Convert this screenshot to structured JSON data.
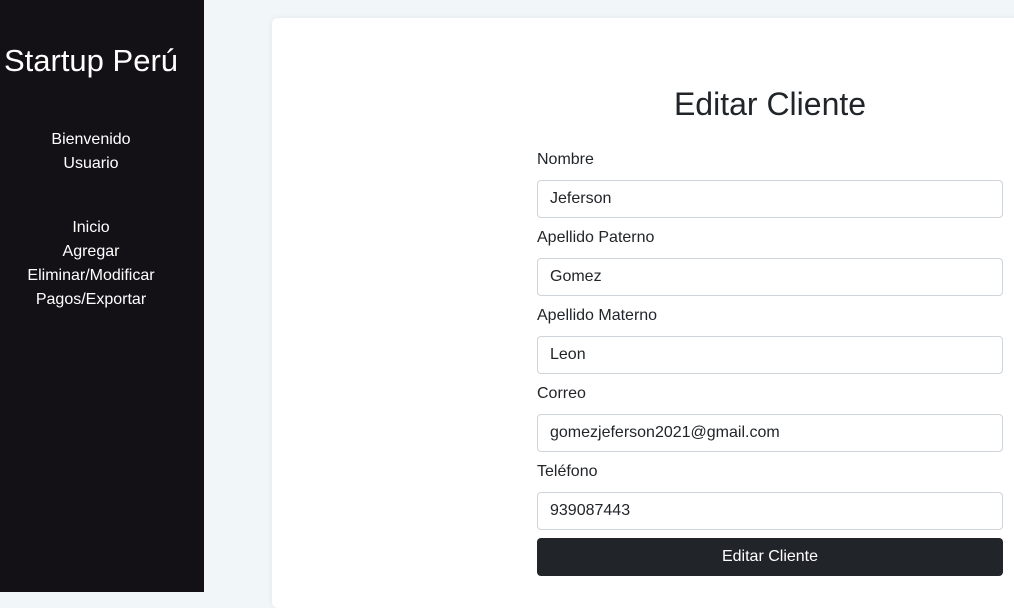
{
  "sidebar": {
    "brand": "Startup Perú",
    "welcome_line1": "Bienvenido",
    "welcome_line2": "Usuario",
    "nav": [
      "Inicio",
      "Agregar",
      "Eliminar/Modificar",
      "Pagos/Exportar"
    ]
  },
  "form": {
    "title": "Editar Cliente",
    "fields": [
      {
        "label": "Nombre",
        "value": "Jeferson"
      },
      {
        "label": "Apellido Paterno",
        "value": "Gomez"
      },
      {
        "label": "Apellido Materno",
        "value": "Leon"
      },
      {
        "label": "Correo",
        "value": "gomezjeferson2021@gmail.com"
      },
      {
        "label": "Teléfono",
        "value": "939087443"
      }
    ],
    "submit_label": "Editar Cliente"
  },
  "colors": {
    "sidebar_bg": "#141116",
    "page_bg": "#f1f7f9",
    "button_bg": "#212529"
  }
}
